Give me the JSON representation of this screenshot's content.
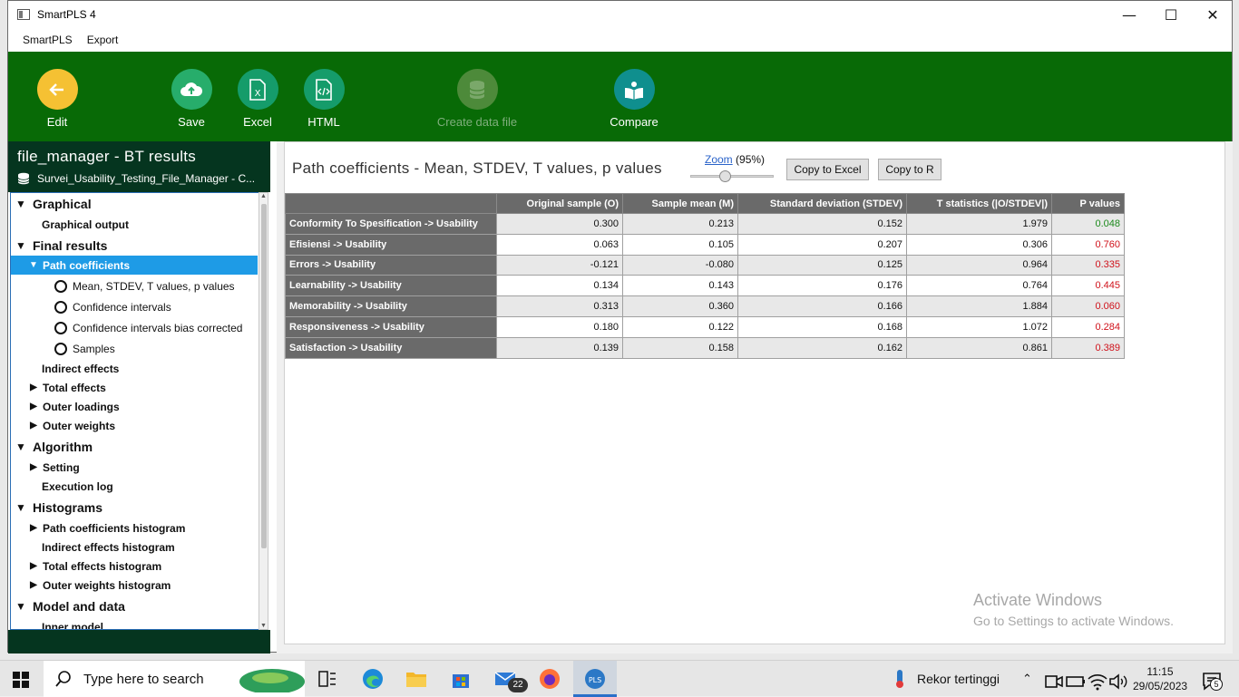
{
  "window": {
    "title": "SmartPLS 4"
  },
  "menu": [
    "SmartPLS",
    "Export"
  ],
  "toolbar": {
    "edit": "Edit",
    "save": "Save",
    "excel": "Excel",
    "html": "HTML",
    "create_data_file": "Create data file",
    "compare": "Compare"
  },
  "left_panel": {
    "title": "file_manager - BT results",
    "dataset": "Survei_Usability_Testing_File_Manager - C...",
    "tree": {
      "graphical": "Graphical",
      "graphical_output": "Graphical output",
      "final_results": "Final results",
      "path_coefficients": "Path coefficients",
      "opt_mean": "Mean, STDEV, T values, p values",
      "opt_ci": "Confidence intervals",
      "opt_cibc": "Confidence intervals bias corrected",
      "opt_samples": "Samples",
      "indirect_effects": "Indirect effects",
      "total_effects": "Total effects",
      "outer_loadings": "Outer loadings",
      "outer_weights": "Outer weights",
      "algorithm": "Algorithm",
      "setting": "Setting",
      "execution_log": "Execution log",
      "histograms": "Histograms",
      "path_hist": "Path coefficients histogram",
      "indirect_hist": "Indirect effects histogram",
      "total_hist": "Total effects histogram",
      "outer_weights_hist": "Outer weights histogram",
      "model_and_data": "Model and data",
      "inner_model": "Inner model"
    }
  },
  "content": {
    "title": "Path coefficients - Mean, STDEV, T values, p values",
    "zoom_link": "Zoom",
    "zoom_value": "(95%)",
    "zoom_level_percent": 95,
    "copy_excel": "Copy to Excel",
    "copy_r": "Copy to R",
    "table": {
      "headers": [
        "",
        "Original sample (O)",
        "Sample mean (M)",
        "Standard deviation (STDEV)",
        "T statistics (|O/STDEV|)",
        "P values"
      ],
      "rows": [
        {
          "label": "Conformity To Spesification -> Usability",
          "o": "0.300",
          "m": "0.213",
          "sd": "0.152",
          "t": "1.979",
          "p": "0.048",
          "p_sig": true
        },
        {
          "label": "Efisiensi -> Usability",
          "o": "0.063",
          "m": "0.105",
          "sd": "0.207",
          "t": "0.306",
          "p": "0.760",
          "p_sig": false
        },
        {
          "label": "Errors -> Usability",
          "o": "-0.121",
          "m": "-0.080",
          "sd": "0.125",
          "t": "0.964",
          "p": "0.335",
          "p_sig": false
        },
        {
          "label": "Learnability -> Usability",
          "o": "0.134",
          "m": "0.143",
          "sd": "0.176",
          "t": "0.764",
          "p": "0.445",
          "p_sig": false
        },
        {
          "label": "Memorability -> Usability",
          "o": "0.313",
          "m": "0.360",
          "sd": "0.166",
          "t": "1.884",
          "p": "0.060",
          "p_sig": false
        },
        {
          "label": "Responsiveness -> Usability",
          "o": "0.180",
          "m": "0.122",
          "sd": "0.168",
          "t": "1.072",
          "p": "0.284",
          "p_sig": false
        },
        {
          "label": "Satisfaction -> Usability",
          "o": "0.139",
          "m": "0.158",
          "sd": "0.162",
          "t": "0.861",
          "p": "0.389",
          "p_sig": false
        }
      ]
    }
  },
  "watermark": {
    "line1": "Activate Windows",
    "line2": "Go to Settings to activate Windows."
  },
  "taskbar": {
    "search_placeholder": "Type here to search",
    "mail_badge": "22",
    "weather": "Rekor tertinggi",
    "time": "11:15",
    "date": "29/05/2023",
    "notif_count": "5"
  },
  "colors": {
    "toolbar_bg": "#086a06",
    "panel_dark": "#05351f",
    "selected": "#1e9be6",
    "p_significant": "#1c8a1c",
    "p_nonsignificant": "#d0121b"
  }
}
